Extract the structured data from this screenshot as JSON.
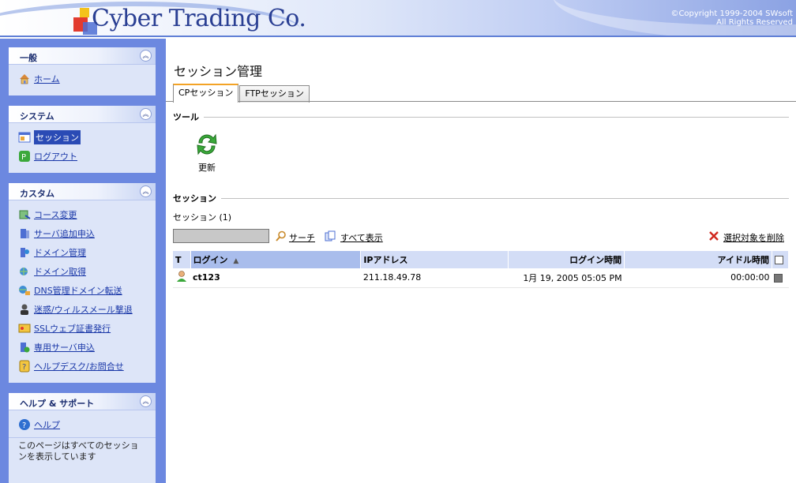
{
  "header": {
    "logo_text": "Cyber Trading Co.",
    "copyright_line1": "©Copyright 1999-2004 SWsoft",
    "copyright_line2": "All Rights Reserved"
  },
  "sidebar": {
    "general": {
      "title": "一般",
      "items": [
        {
          "label": "ホーム",
          "icon": "home-icon"
        }
      ]
    },
    "system": {
      "title": "システム",
      "items": [
        {
          "label": "セッション",
          "icon": "session-icon"
        },
        {
          "label": "ログアウト",
          "icon": "logout-icon"
        }
      ]
    },
    "custom": {
      "title": "カスタム",
      "items": [
        {
          "label": "コース変更",
          "icon": "course-change-icon"
        },
        {
          "label": "サーバ追加申込",
          "icon": "server-add-icon"
        },
        {
          "label": "ドメイン管理",
          "icon": "domain-manage-icon"
        },
        {
          "label": "ドメイン取得",
          "icon": "domain-acquire-icon"
        },
        {
          "label": "DNS管理ドメイン転送",
          "icon": "dns-transfer-icon"
        },
        {
          "label": "迷惑/ウィルスメール撃退",
          "icon": "spam-virus-icon"
        },
        {
          "label": "SSLウェブ証書発行",
          "icon": "ssl-certificate-icon"
        },
        {
          "label": "専用サーバ申込",
          "icon": "dedicated-server-icon"
        },
        {
          "label": "ヘルプデスク/お問合せ",
          "icon": "helpdesk-icon"
        }
      ]
    },
    "help": {
      "title": "ヘルプ & サポート",
      "items": [
        {
          "label": "ヘルプ",
          "icon": "help-icon"
        }
      ],
      "note": "このページはすべてのセッションを表示しています"
    }
  },
  "main": {
    "page_title": "セッション管理",
    "tabs": [
      {
        "label": "CPセッション",
        "active": true
      },
      {
        "label": "FTPセッション",
        "active": false
      }
    ],
    "tools_heading": "ツール",
    "refresh_label": "更新",
    "sessions_heading": "セッション",
    "session_count": "セッション (1)",
    "search_label": "サーチ",
    "show_all_label": "すべて表示",
    "delete_selected_label": "選択対象を削除",
    "table": {
      "columns": {
        "type": "T",
        "login": "ログイン",
        "ip": "IPアドレス",
        "login_time": "ログイン時間",
        "idle_time": "アイドル時間"
      },
      "rows": [
        {
          "login": "ct123",
          "ip": "211.18.49.78",
          "login_time": "1月 19, 2005 05:05 PM",
          "idle_time": "00:00:00"
        }
      ]
    }
  }
}
